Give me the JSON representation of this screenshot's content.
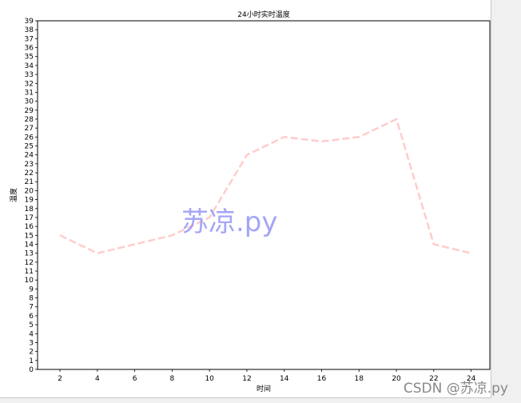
{
  "chart_data": {
    "type": "line",
    "title": "24小时实时温度",
    "xlabel": "时间",
    "ylabel": "温度",
    "x": [
      2,
      4,
      6,
      8,
      10,
      12,
      14,
      16,
      18,
      20,
      22,
      24
    ],
    "x_ticks": [
      "2",
      "4",
      "6",
      "8",
      "10",
      "12",
      "14",
      "16",
      "18",
      "20",
      "22",
      "24"
    ],
    "series": [
      {
        "values": [
          15,
          13,
          14,
          15,
          17,
          24,
          26,
          25.5,
          26,
          28,
          14,
          13
        ]
      }
    ],
    "xlim": [
      0.8,
      25
    ],
    "ylim": [
      0,
      39
    ],
    "y_tick_step": 1,
    "grid": false,
    "line_color": "#ffcccc",
    "line_style": "dashed"
  },
  "watermarks": {
    "center": "苏凉.py",
    "corner": "CSDN @苏凉.py"
  }
}
